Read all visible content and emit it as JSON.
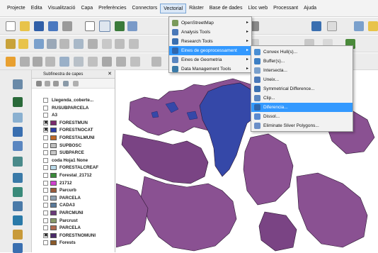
{
  "menubar": {
    "items": [
      "Projecte",
      "Edita",
      "Visualització",
      "Capa",
      "Preferències",
      "Connectors",
      "Vectorial",
      "Ràster",
      "Base de dades",
      "Lloc web",
      "Processant",
      "Ajuda"
    ],
    "active": "Vectorial"
  },
  "vector_menu": {
    "items": [
      {
        "label": "OpenStreetMap",
        "icon": "osm-icon"
      },
      {
        "label": "Analysis Tools",
        "icon": "analysis-icon"
      },
      {
        "label": "Research Tools",
        "icon": "research-icon"
      },
      {
        "label": "Eines de geoprocessament",
        "icon": "geoprocessing-icon"
      },
      {
        "label": "Eines de Geometria",
        "icon": "geometry-icon"
      },
      {
        "label": "Data Management Tools",
        "icon": "data-management-icon"
      }
    ],
    "highlighted": "Eines de geoprocessament"
  },
  "geoprocessing_submenu": {
    "items": [
      {
        "label": "Convex Hull(s)...",
        "color": "#4a8fd4"
      },
      {
        "label": "Buffer(s)...",
        "color": "#3d7fc4"
      },
      {
        "label": "Intersecta...",
        "color": "#7aa0cc"
      },
      {
        "label": "Uneix...",
        "color": "#4a78b8"
      },
      {
        "label": "Symmetrical Difference...",
        "color": "#3a6fb0"
      },
      {
        "label": "Clip...",
        "color": "#5a86c0"
      },
      {
        "label": "Diferencia...",
        "color": "#2f66ad"
      },
      {
        "label": "Dissol...",
        "color": "#5b8ad0"
      },
      {
        "label": "Eliminate Sliver Polygons...",
        "color": "#6b8fc8"
      }
    ],
    "highlighted": "Diferencia..."
  },
  "layers_panel": {
    "title": "Subfinestra de capes",
    "layers": [
      {
        "label": "Llegenda_coberte...",
        "checked": false,
        "color": ""
      },
      {
        "label": "RUSUBPARCELA",
        "checked": false,
        "color": ""
      },
      {
        "label": "A3",
        "checked": false,
        "color": ""
      },
      {
        "label": "FORESTMUN",
        "checked": true,
        "color": "#7a2b6e"
      },
      {
        "label": "FORESTNOCAT",
        "checked": true,
        "color": "#2b3da8"
      },
      {
        "label": "FORESTALMUNI",
        "checked": false,
        "color": "#c06a2a"
      },
      {
        "label": "SUPBOSC",
        "checked": false,
        "color": "#bfbfbf"
      },
      {
        "label": "SUBPARCE",
        "checked": false,
        "color": "#c8c8c8"
      },
      {
        "label": "coda Hoja1 None",
        "checked": false,
        "color": ""
      },
      {
        "label": "FORESTALCREAF",
        "checked": false,
        "color": "#b8d8e8"
      },
      {
        "label": "Forestal_21712",
        "checked": false,
        "color": "#3a8a3a"
      },
      {
        "label": "21712",
        "checked": false,
        "color": "#d040d0"
      },
      {
        "label": "Parcurb",
        "checked": false,
        "color": "#9a5a3a"
      },
      {
        "label": "PARCELA",
        "checked": false,
        "color": "#8fa0b0"
      },
      {
        "label": "CADA3",
        "checked": false,
        "color": "#5a7a9a"
      },
      {
        "label": "PARCMUNI",
        "checked": false,
        "color": "#6a3a7a"
      },
      {
        "label": "Parcrust",
        "checked": false,
        "color": "#8a9a6a"
      },
      {
        "label": "PARCELA",
        "checked": false,
        "color": "#b06a50"
      },
      {
        "label": "FORESTNOMUNI",
        "checked": true,
        "color": "#4a2a6a"
      },
      {
        "label": "Forests",
        "checked": false,
        "color": "#8a5a2a"
      }
    ]
  },
  "colors": {
    "map_purple": "#8a5192",
    "map_blue": "#3548a8",
    "highlight": "#3399ff"
  }
}
